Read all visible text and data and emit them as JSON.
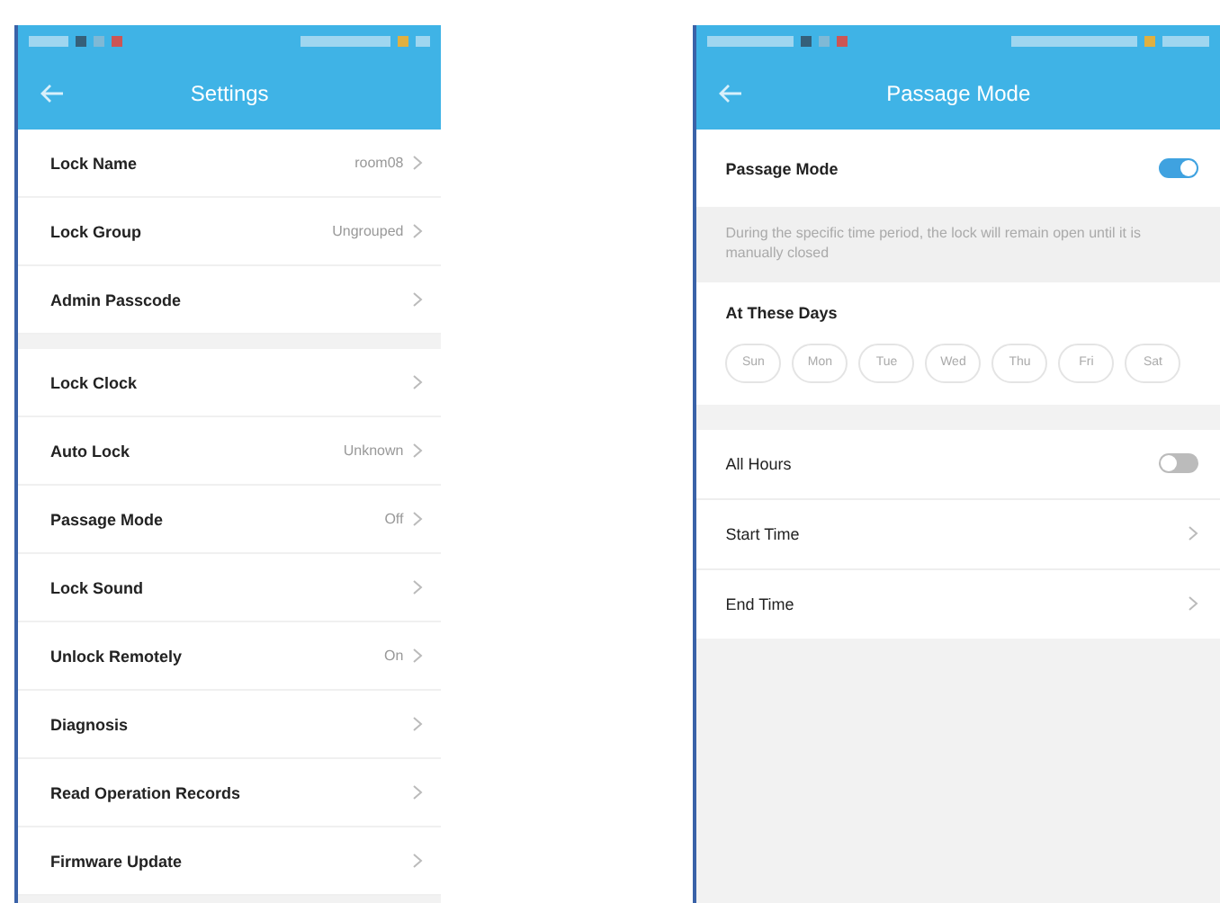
{
  "settings_screen": {
    "title": "Settings",
    "sections": [
      {
        "items": [
          {
            "label": "Lock Name",
            "value": "room08"
          },
          {
            "label": "Lock Group",
            "value": "Ungrouped"
          },
          {
            "label": "Admin Passcode"
          }
        ]
      },
      {
        "items": [
          {
            "label": "Lock Clock"
          },
          {
            "label": "Auto Lock",
            "value": "Unknown"
          },
          {
            "label": "Passage Mode",
            "value": "Off"
          },
          {
            "label": "Lock Sound"
          },
          {
            "label": "Unlock Remotely",
            "value": "On"
          },
          {
            "label": "Diagnosis"
          },
          {
            "label": "Read Operation Records"
          },
          {
            "label": "Firmware Update"
          }
        ]
      }
    ]
  },
  "passage_screen": {
    "title": "Passage Mode",
    "mode": {
      "label": "Passage Mode",
      "on": true
    },
    "description": "During the specific time period, the lock will remain open until it is manually closed",
    "days_label": "At These Days",
    "days": [
      {
        "label": "Sun",
        "selected": false
      },
      {
        "label": "Mon",
        "selected": false
      },
      {
        "label": "Tue",
        "selected": false
      },
      {
        "label": "Wed",
        "selected": false
      },
      {
        "label": "Thu",
        "selected": false
      },
      {
        "label": "Fri",
        "selected": false
      },
      {
        "label": "Sat",
        "selected": false
      }
    ],
    "all_hours": {
      "label": "All Hours",
      "on": false
    },
    "times": [
      {
        "label": "Start Time"
      },
      {
        "label": "End Time"
      }
    ]
  }
}
